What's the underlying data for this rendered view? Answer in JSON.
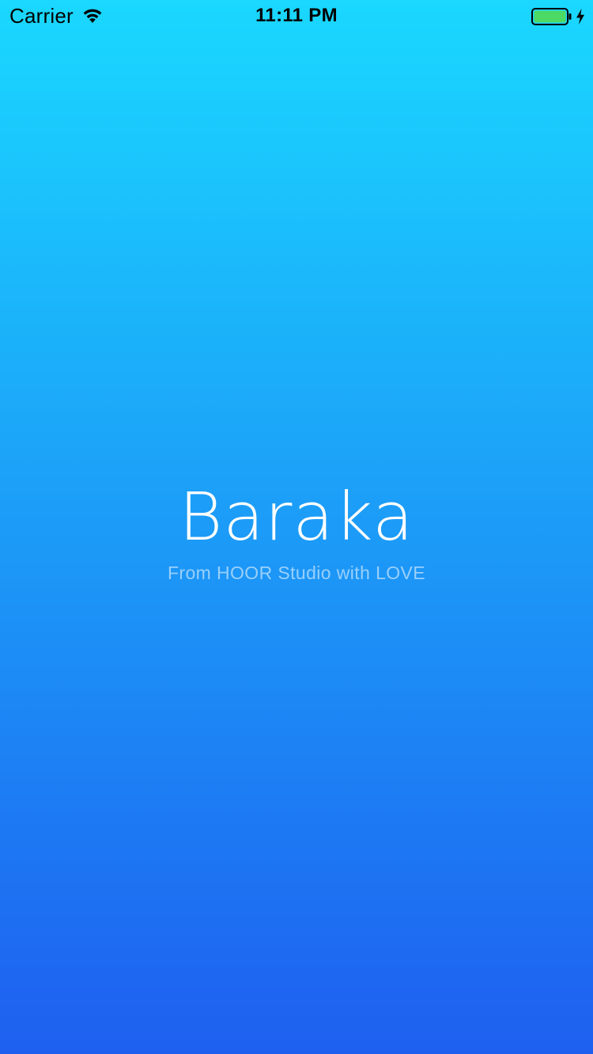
{
  "status_bar": {
    "carrier": "Carrier",
    "time": "11:11 PM",
    "battery_level": 1.0,
    "charging": true,
    "battery_color": "#4cd964",
    "icons": {
      "wifi": "wifi-icon",
      "battery": "battery-icon",
      "charging": "bolt-icon"
    }
  },
  "splash": {
    "title": "Baraka",
    "subtitle": "From HOOR Studio with LOVE"
  },
  "colors": {
    "gradient_top": "#1ad8ff",
    "gradient_bottom": "#1e5ff0",
    "title_text": "#ffffff"
  }
}
